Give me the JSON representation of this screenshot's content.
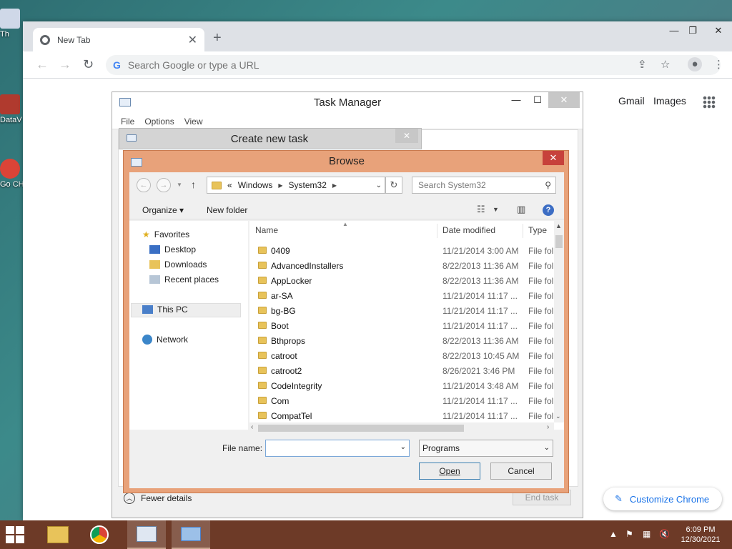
{
  "desktop": {
    "icons": [
      {
        "label": "Th"
      },
      {
        "label": "DataV"
      },
      {
        "label": "Go CH"
      }
    ]
  },
  "chrome": {
    "tab_title": "New Tab",
    "omnibox_placeholder": "Search Google or type a URL",
    "links": {
      "gmail": "Gmail",
      "images": "Images"
    },
    "customize_label": "Customize Chrome"
  },
  "task_manager": {
    "title": "Task Manager",
    "menu": [
      "File",
      "Options",
      "View"
    ],
    "fewer_details": "Fewer details",
    "end_task": "End task"
  },
  "create_task": {
    "title": "Create new task"
  },
  "browse": {
    "title": "Browse",
    "breadcrumb": [
      "«",
      "Windows",
      "System32"
    ],
    "search_placeholder": "Search System32",
    "toolbar": {
      "organize": "Organize",
      "new_folder": "New folder"
    },
    "nav": {
      "favorites": "Favorites",
      "desktop": "Desktop",
      "downloads": "Downloads",
      "recent": "Recent places",
      "this_pc": "This PC",
      "network": "Network"
    },
    "columns": {
      "name": "Name",
      "date": "Date modified",
      "type": "Type"
    },
    "files": [
      {
        "name": "0409",
        "date": "11/21/2014 3:00 AM",
        "type": "File fol"
      },
      {
        "name": "AdvancedInstallers",
        "date": "8/22/2013 11:36 AM",
        "type": "File fol"
      },
      {
        "name": "AppLocker",
        "date": "8/22/2013 11:36 AM",
        "type": "File fol"
      },
      {
        "name": "ar-SA",
        "date": "11/21/2014 11:17 ...",
        "type": "File fol"
      },
      {
        "name": "bg-BG",
        "date": "11/21/2014 11:17 ...",
        "type": "File fol"
      },
      {
        "name": "Boot",
        "date": "11/21/2014 11:17 ...",
        "type": "File fol"
      },
      {
        "name": "Bthprops",
        "date": "8/22/2013 11:36 AM",
        "type": "File fol"
      },
      {
        "name": "catroot",
        "date": "8/22/2013 10:45 AM",
        "type": "File fol"
      },
      {
        "name": "catroot2",
        "date": "8/26/2021 3:46 PM",
        "type": "File fol"
      },
      {
        "name": "CodeIntegrity",
        "date": "11/21/2014 3:48 AM",
        "type": "File fol"
      },
      {
        "name": "Com",
        "date": "11/21/2014 11:17 ...",
        "type": "File fol"
      },
      {
        "name": "CompatTel",
        "date": "11/21/2014 11:17 ...",
        "type": "File fol"
      }
    ],
    "file_name_label": "File name:",
    "file_name_value": "",
    "file_type": "Programs",
    "open_label": "Open",
    "cancel_label": "Cancel"
  },
  "taskbar": {
    "clock_time": "6:09 PM",
    "clock_date": "12/30/2021"
  }
}
